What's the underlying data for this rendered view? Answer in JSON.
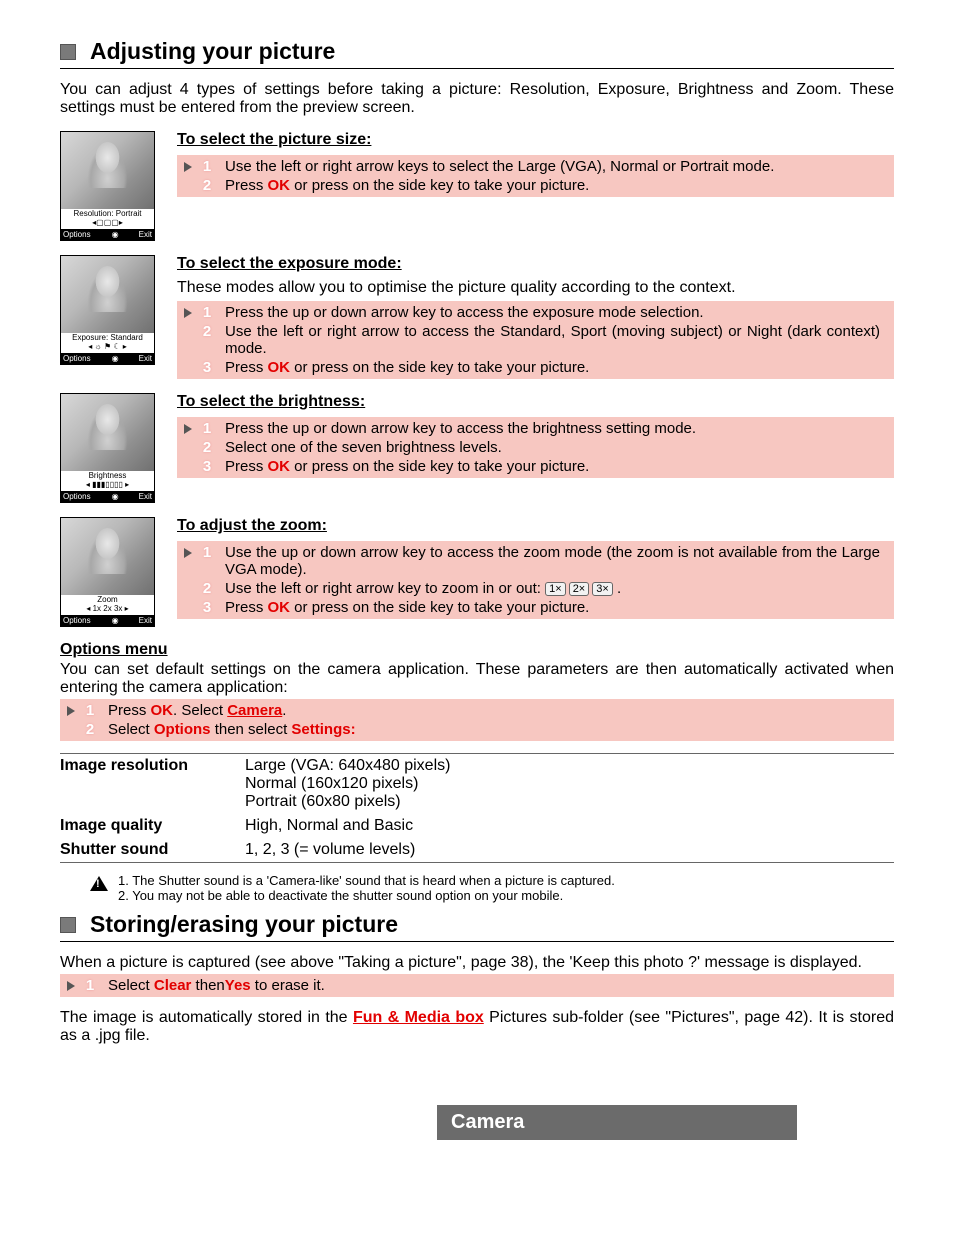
{
  "section1": {
    "title": "Adjusting your picture",
    "intro": "You can adjust 4 types of settings before taking a picture: Resolution, Exposure, Brightness and Zoom. These settings must be entered from the preview screen."
  },
  "thumb_soft": {
    "left": "Options",
    "mid": "◉",
    "right": "Exit"
  },
  "thumbs": {
    "size": "Resolution: Portrait\n◂▢▢▢▸",
    "exposure": "Exposure: Standard\n◂ ☼ ⚑ ☾ ▸",
    "brightness": "Brightness\n◂ ▮▮▮▯▯▯▯ ▸",
    "zoom": "Zoom\n◂ 1x  2x  3x ▸"
  },
  "picsize": {
    "heading": "To select the picture size:",
    "steps": [
      {
        "n": "1",
        "pre": "Use the left or right arrow keys to select the Large (VGA), Normal or Portrait mode."
      },
      {
        "n": "2",
        "pre": "Press ",
        "red": "OK",
        "post": " or press on the side key to take your picture."
      }
    ]
  },
  "exposure": {
    "heading": "To select the exposure mode:",
    "desc": "These modes allow you to optimise the picture quality according to the context.",
    "steps": [
      {
        "n": "1",
        "pre": "Press the up or down arrow key to access the exposure mode selection."
      },
      {
        "n": "2",
        "pre": "Use the left or right arrow to access the Standard, Sport (moving subject) or Night (dark context) mode."
      },
      {
        "n": "3",
        "pre": "Press ",
        "red": "OK",
        "post": " or press on the side key to take your picture."
      }
    ]
  },
  "brightness": {
    "heading": "To select the brightness:",
    "steps": [
      {
        "n": "1",
        "pre": "Press the up or down arrow key to access the brightness setting mode."
      },
      {
        "n": "2",
        "pre": "Select one of the seven brightness levels."
      },
      {
        "n": "3",
        "pre": "Press ",
        "red": "OK",
        "post": " or press on the side key to take your picture."
      }
    ]
  },
  "zoom": {
    "heading": "To adjust the zoom:",
    "steps": [
      {
        "n": "1",
        "pre": "Use the up or down arrow key to access the zoom mode (the zoom is not available from the Large VGA mode)."
      },
      {
        "n": "2",
        "pre": "Use the left or right arrow key to zoom in or out: ",
        "badges": [
          "1×",
          "2×",
          "3×"
        ],
        "post": " ."
      },
      {
        "n": "3",
        "pre": "Press ",
        "red": "OK",
        "post": " or press on the side key to take your picture."
      }
    ]
  },
  "options": {
    "heading": "Options menu",
    "desc": "You can set default settings on the camera application. These parameters are then automatically activated when entering the camera application:",
    "steps": [
      {
        "n": "1",
        "parts": [
          "Press ",
          {
            "red": "OK"
          },
          ". Select ",
          {
            "redu": "Camera"
          },
          "."
        ]
      },
      {
        "n": "2",
        "parts": [
          "Select ",
          {
            "red": "Options"
          },
          " then select ",
          {
            "red": "Settings:"
          }
        ]
      }
    ],
    "table": [
      {
        "label": "Image resolution",
        "value": "Large (VGA: 640x480 pixels)\nNormal (160x120 pixels)\nPortrait (60x80 pixels)"
      },
      {
        "label": "Image quality",
        "value": "High, Normal and Basic"
      },
      {
        "label": "Shutter sound",
        "value": "1, 2, 3 (= volume levels)"
      }
    ],
    "notes": [
      "1. The Shutter sound is a 'Camera-like' sound that is heard when a picture is captured.",
      "2. You may not be able to deactivate the shutter sound option on your mobile."
    ]
  },
  "section2": {
    "title": "Storing/erasing your picture",
    "desc": "When a picture is captured (see above \"Taking a picture\", page 38), the 'Keep this photo ?' message is displayed.",
    "step": {
      "n": "1",
      "parts": [
        "Select ",
        {
          "red": "Clear"
        },
        " then",
        {
          "red": "Yes"
        },
        " to erase it."
      ]
    },
    "desc2_pre": "The image is automatically stored in the ",
    "desc2_link": "Fun & Media box",
    "desc2_post": " Pictures sub-folder (see \"Pictures\", page 42). It is stored  as a .jpg file."
  },
  "footer": "Camera"
}
